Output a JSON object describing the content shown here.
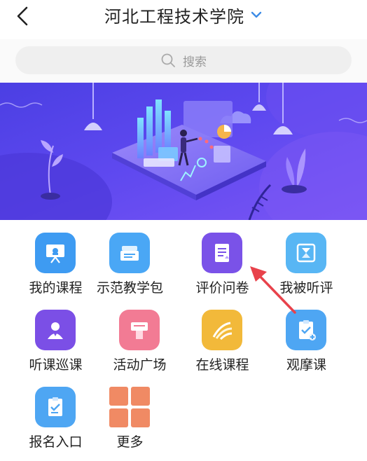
{
  "header": {
    "title": "河北工程技术学院"
  },
  "search": {
    "placeholder": "搜索"
  },
  "menu": [
    {
      "label": "我的课程",
      "icon": "presentation-board-icon"
    },
    {
      "label": "示范教学包",
      "icon": "package-stack-icon"
    },
    {
      "label": "评价问卷",
      "icon": "survey-document-icon"
    },
    {
      "label": "我被听评",
      "icon": "hourglass-frame-icon"
    },
    {
      "label": "听课巡课",
      "icon": "teacher-profile-icon"
    },
    {
      "label": "活动广场",
      "icon": "podium-icon"
    },
    {
      "label": "在线课程",
      "icon": "online-course-icon"
    },
    {
      "label": "观摩课",
      "icon": "clipboard-check-icon"
    },
    {
      "label": "报名入口",
      "icon": "registration-clipboard-icon"
    },
    {
      "label": "更多",
      "icon": "more-grid-icon"
    }
  ],
  "colors": {
    "accent": "#3d8be6",
    "banner_start": "#5a3ff2",
    "banner_end": "#7c5cf6",
    "annotation_arrow": "#e8424b"
  }
}
